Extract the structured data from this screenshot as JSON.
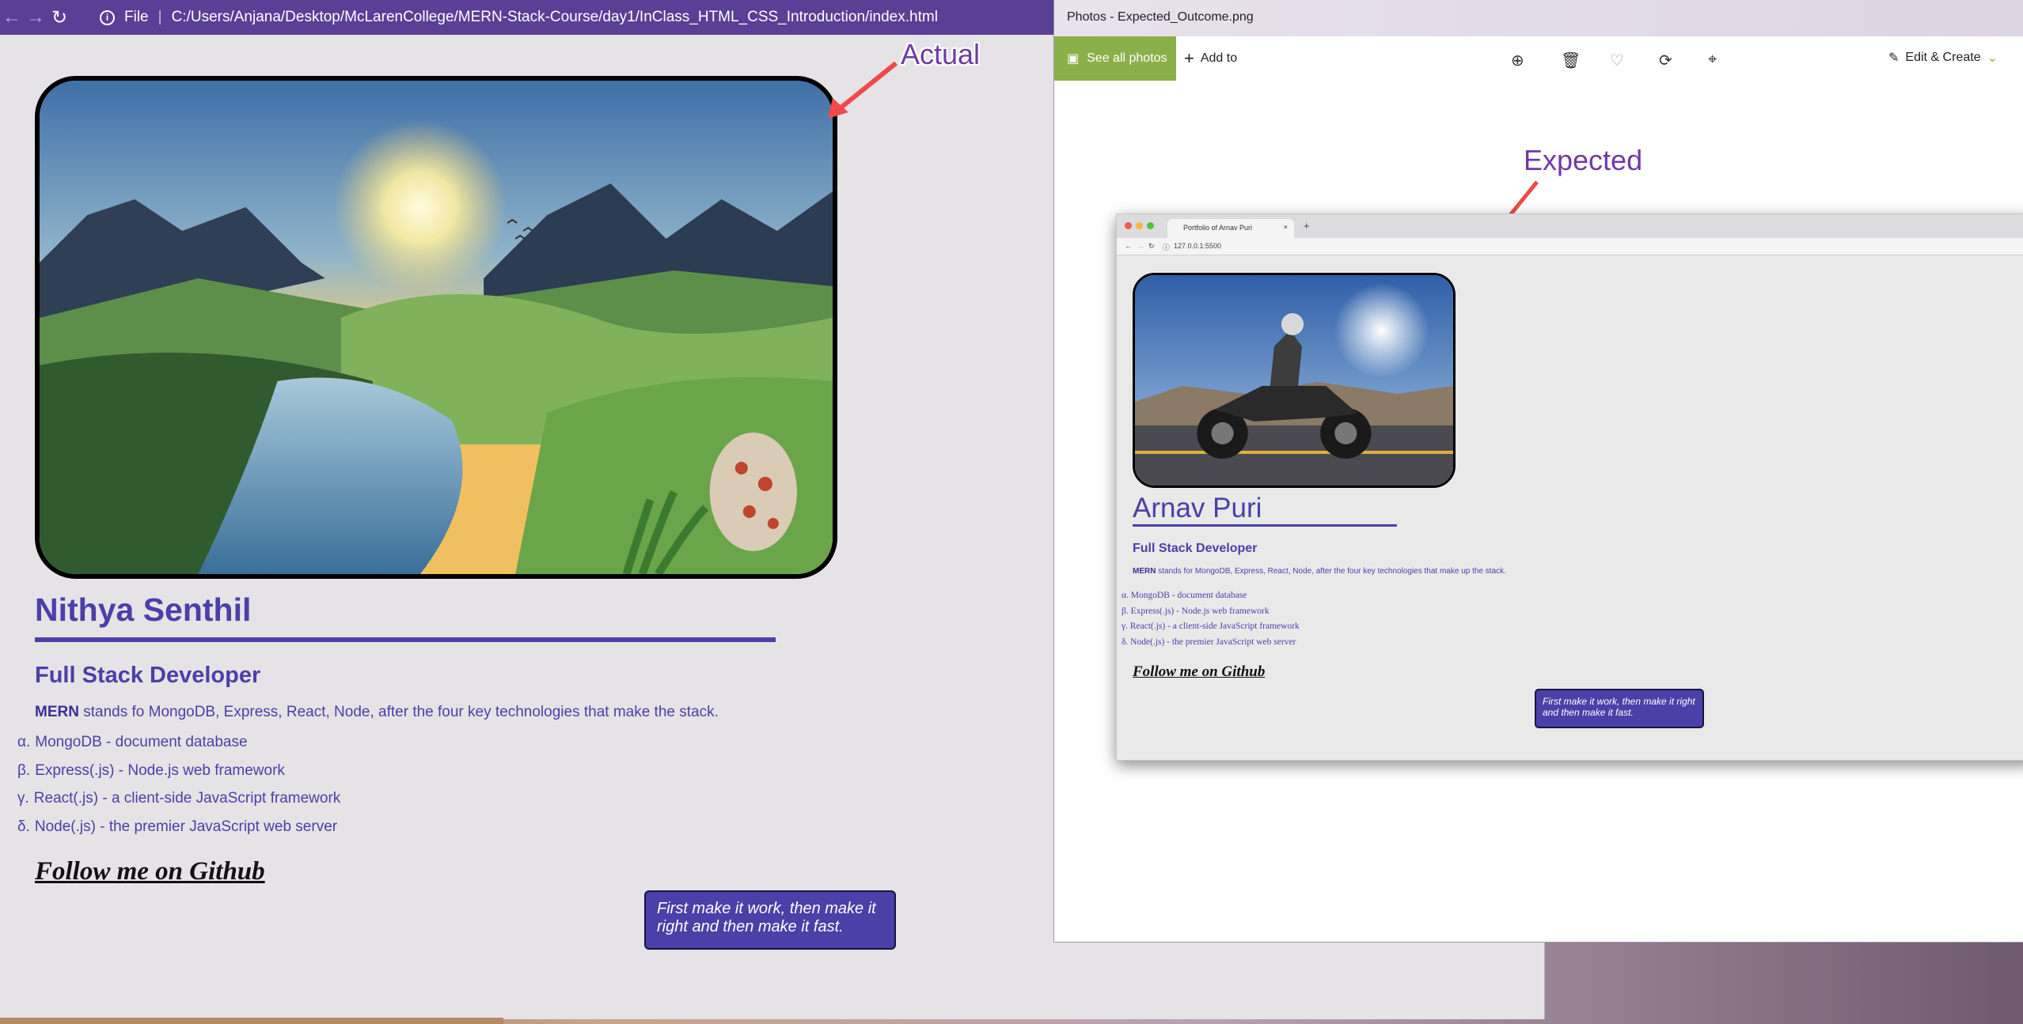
{
  "browser": {
    "back_icon": "arrow-left-icon",
    "forward_icon": "arrow-right-icon",
    "reload_icon": "reload-icon",
    "scheme_label": "File",
    "url": "C:/Users/Anjana/Desktop/McLarenCollege/MERN-Stack-Course/day1/InClass_HTML_CSS_Introduction/index.html",
    "accent_color": "#5b3e96"
  },
  "actual_page": {
    "name": "Nithya Senthil",
    "role": "Full Stack Developer",
    "intro_strong": "MERN",
    "intro_rest": " stands fo MongoDB, Express, React, Node, after the four key technologies that make the stack.",
    "stack": [
      {
        "marker": "α.",
        "text": "MongoDB - document database"
      },
      {
        "marker": "β.",
        "text": "Express(.js) - Node.js web framework"
      },
      {
        "marker": "γ.",
        "text": "React(.js) - a client-side JavaScript framework"
      },
      {
        "marker": "δ.",
        "text": "Node(.js) - the premier JavaScript web server"
      }
    ],
    "follow_link": "Follow me on Github",
    "quote": "First make it work, then make it right and then make it fast.",
    "theme_color": "#4b3fa8"
  },
  "annotations": {
    "actual_label": "Actual",
    "expected_label": "Expected",
    "arrow_color": "#f04a4a"
  },
  "photos_app": {
    "title": "Photos - Expected_Outcome.png",
    "see_all": "See all photos",
    "add_to": "Add to",
    "edit_create": "Edit & Create",
    "accent_color": "#8ab04a"
  },
  "expected_page": {
    "tab_title": "Portfolio of Arnav Puri",
    "url": "127.0.0.1:5500",
    "name": "Arnav Puri",
    "role": "Full Stack Developer",
    "intro_strong": "MERN",
    "intro_rest": " stands for MongoDB, Express, React, Node, after the four key technologies that make up the stack.",
    "stack": [
      {
        "marker": "α.",
        "text": "MongoDB - document database"
      },
      {
        "marker": "β.",
        "text": "Express(.js) - Node.js web framework"
      },
      {
        "marker": "γ.",
        "text": "React(.js) - a client-side JavaScript framework"
      },
      {
        "marker": "δ.",
        "text": "Node(.js) - the premier JavaScript web server"
      }
    ],
    "follow_link": "Follow me on Github",
    "quote": "First make it work, then make it right and then make it fast."
  }
}
